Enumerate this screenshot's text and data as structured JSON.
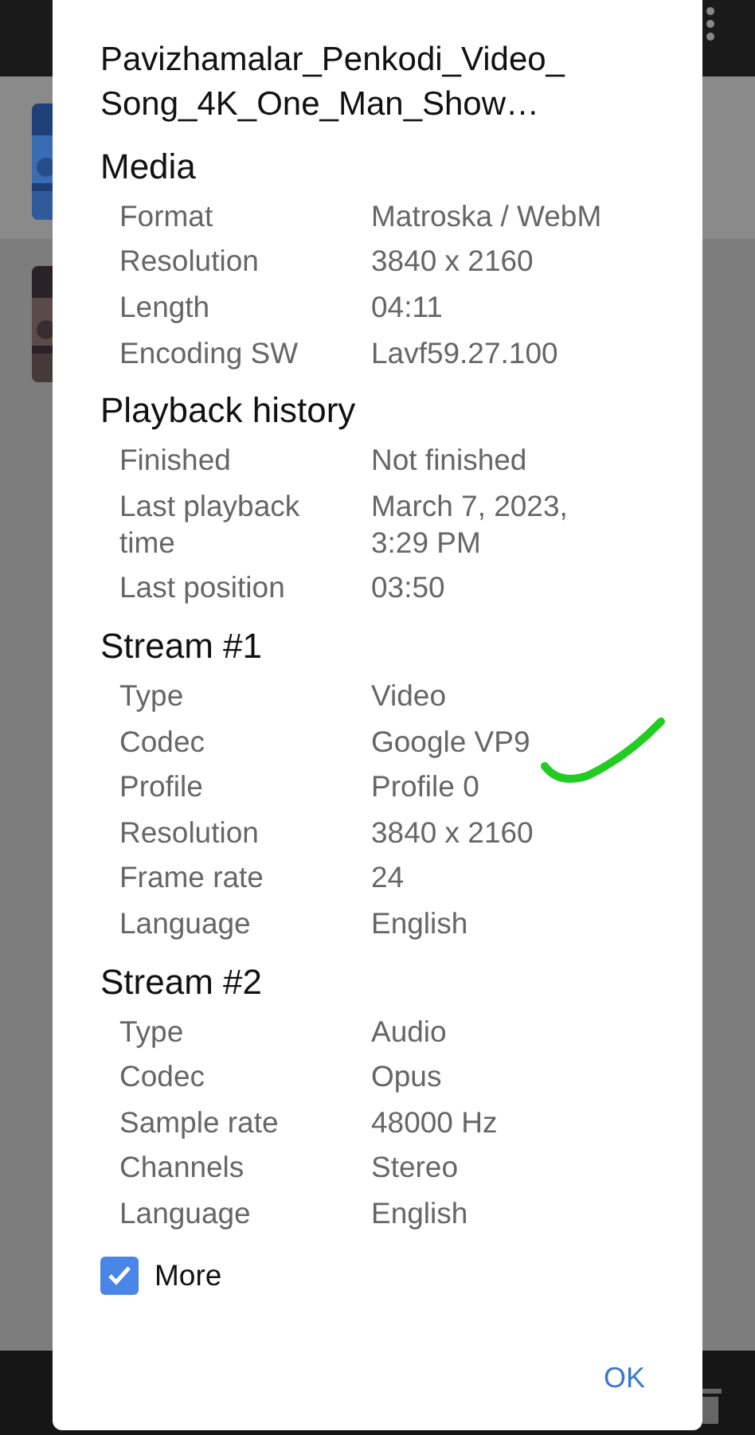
{
  "dialog": {
    "title": "Pavizhamalar_Penkodi_Video_Song_4K_One_Man_Show…",
    "sections": [
      {
        "heading": "Media",
        "rows": [
          {
            "label": "Format",
            "value": "Matroska / WebM"
          },
          {
            "label": "Resolution",
            "value": "3840 x 2160"
          },
          {
            "label": "Length",
            "value": "04:11"
          },
          {
            "label": "Encoding SW",
            "value": "Lavf59.27.100"
          }
        ]
      },
      {
        "heading": "Playback history",
        "rows": [
          {
            "label": "Finished",
            "value": "Not finished"
          },
          {
            "label": "Last playback time",
            "value": "March 7, 2023, 3:29 PM"
          },
          {
            "label": "Last position",
            "value": "03:50"
          }
        ]
      },
      {
        "heading": "Stream #1",
        "rows": [
          {
            "label": "Type",
            "value": "Video"
          },
          {
            "label": "Codec",
            "value": "Google VP9"
          },
          {
            "label": "Profile",
            "value": "Profile 0"
          },
          {
            "label": "Resolution",
            "value": "3840 x 2160"
          },
          {
            "label": "Frame rate",
            "value": "24"
          },
          {
            "label": "Language",
            "value": "English"
          }
        ]
      },
      {
        "heading": "Stream #2",
        "rows": [
          {
            "label": "Type",
            "value": "Audio"
          },
          {
            "label": "Codec",
            "value": "Opus"
          },
          {
            "label": "Sample rate",
            "value": "48000 Hz"
          },
          {
            "label": "Channels",
            "value": "Stereo"
          },
          {
            "label": "Language",
            "value": "English"
          }
        ]
      }
    ],
    "more": {
      "label": "More",
      "checked": true
    },
    "ok_button": "OK"
  }
}
